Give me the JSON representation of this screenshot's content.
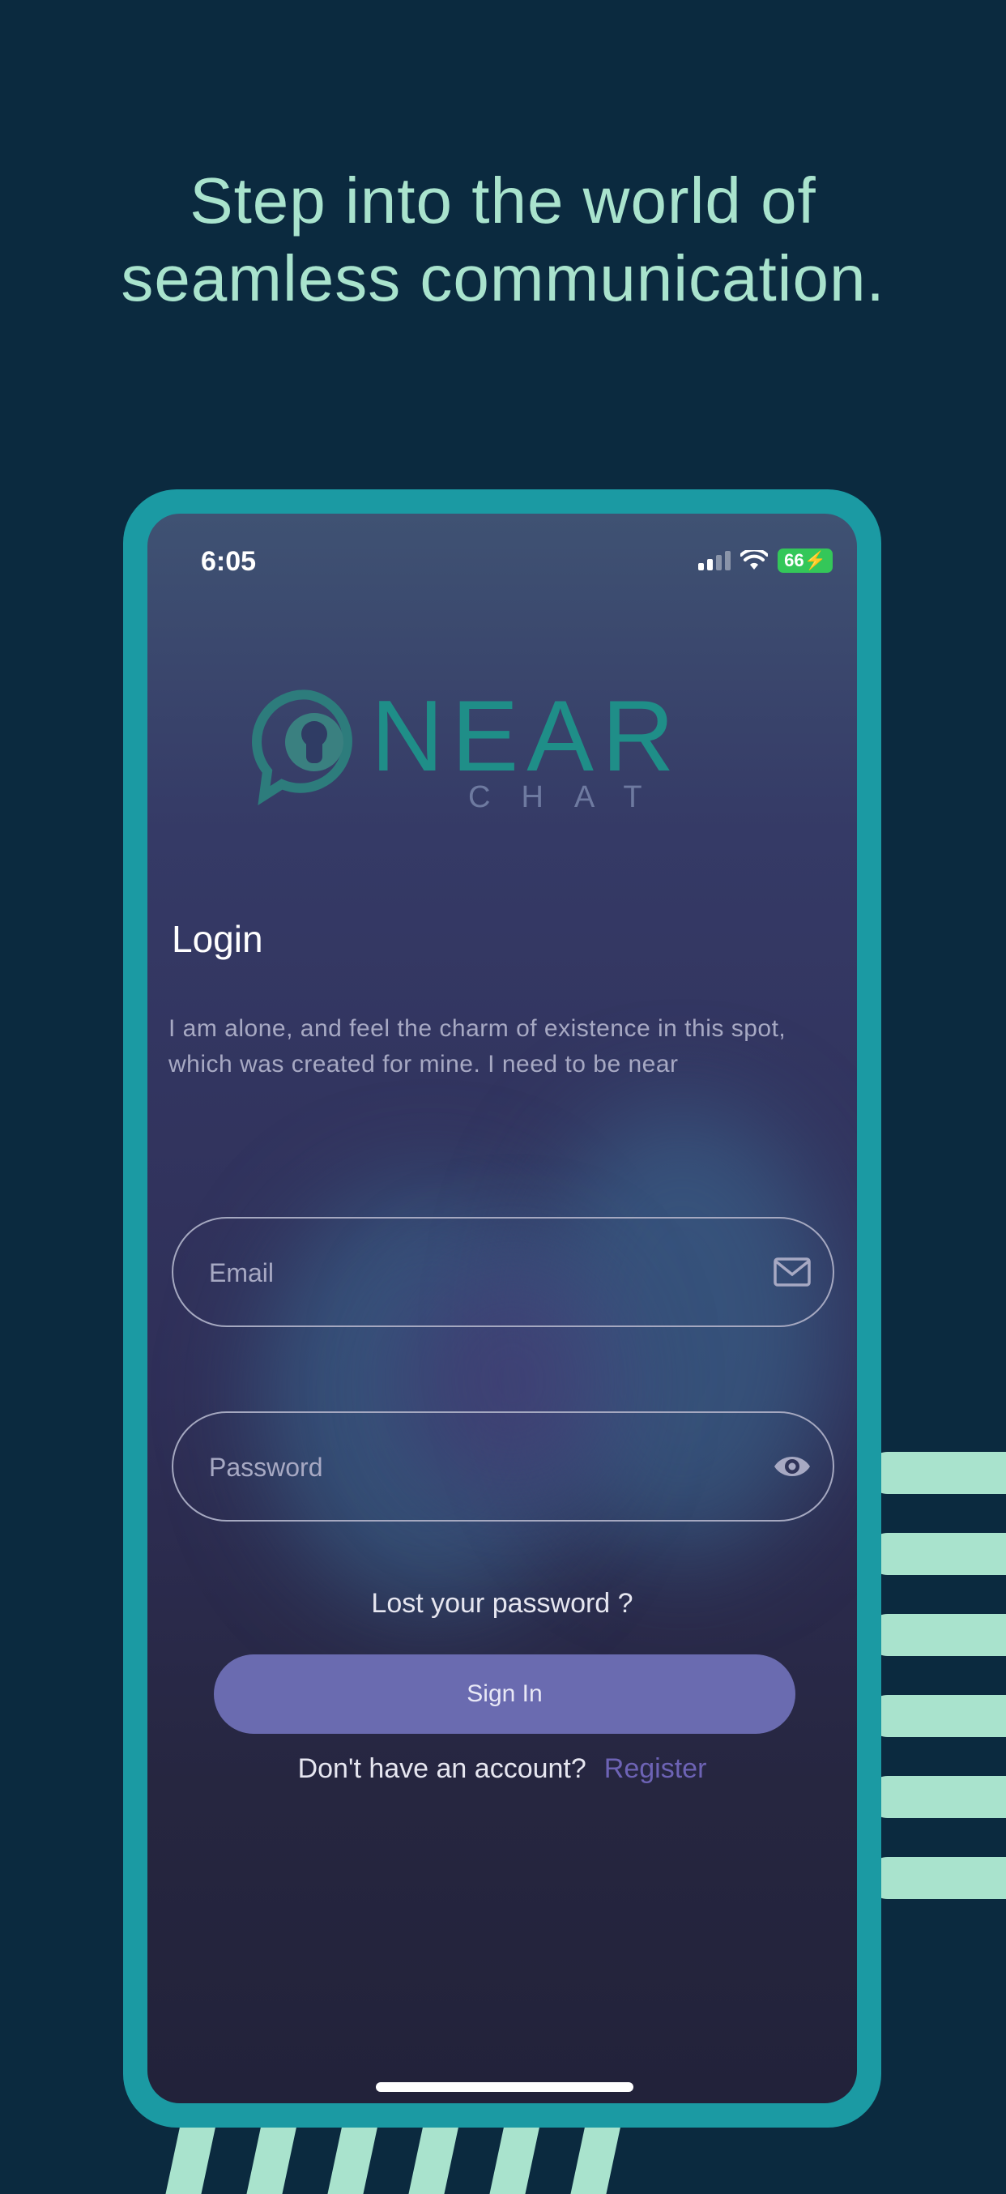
{
  "headline": {
    "line1": "Step into the world of",
    "line2": "seamless communication."
  },
  "status_bar": {
    "time": "6:05",
    "battery": "66"
  },
  "logo": {
    "word": "NEAR",
    "sub": "CHAT"
  },
  "login": {
    "title": "Login",
    "description": "I am alone, and feel the charm of existence in this spot, which was created for mine. I need to be near"
  },
  "email_field": {
    "placeholder": "Email",
    "value": ""
  },
  "password_field": {
    "placeholder": "Password",
    "value": ""
  },
  "lost_password_label": "Lost your password ?",
  "sign_in_label": "Sign In",
  "register": {
    "question": "Don't have an account?",
    "link": "Register"
  },
  "colors": {
    "background": "#0b2a3f",
    "accent_teal": "#1b9aa3",
    "mint": "#a9e3cd",
    "button": "#6a6bb0",
    "link": "#6d63b5"
  }
}
